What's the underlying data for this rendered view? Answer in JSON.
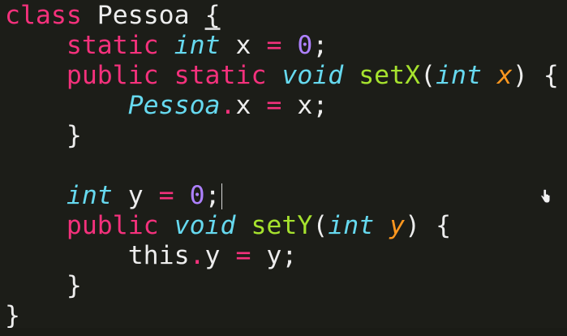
{
  "code": {
    "l1_kw": "class",
    "l1_name": "Pessoa",
    "l1_brace": "{",
    "l2_kw": "static",
    "l2_type": "int",
    "l2_var": "x",
    "l2_op": "=",
    "l2_num": "0",
    "l2_semi": ";",
    "l3_kw1": "public",
    "l3_kw2": "static",
    "l3_type": "void",
    "l3_fn": "setX",
    "l3_paren_open": "(",
    "l3_ptype": "int",
    "l3_param": "x",
    "l3_paren_close": ")",
    "l3_brace": "{",
    "l4_ref": "Pessoa",
    "l4_dot": ".",
    "l4_field": "x",
    "l4_op": "=",
    "l4_val": "x;",
    "l5_close": "}",
    "l7_type": "int",
    "l7_var": "y",
    "l7_op": "=",
    "l7_num": "0",
    "l7_semi": ";",
    "l8_kw": "public",
    "l8_type": "void",
    "l8_fn": "setY",
    "l8_paren_open": "(",
    "l8_ptype": "int",
    "l8_param": "y",
    "l8_paren_close": ")",
    "l8_brace": "{",
    "l9_this": "this",
    "l9_dot": ".",
    "l9_field": "y",
    "l9_op": "=",
    "l9_val": "y;",
    "l10_close": "}",
    "l11_close": "}"
  },
  "colors": {
    "background": "#1c1d18",
    "keyword": "#f4317c",
    "type": "#66d9ef",
    "function": "#a6e22e",
    "number": "#ae81ff",
    "parameter": "#fd971f",
    "text": "#ededed"
  },
  "icons": {
    "pointer": "hand-pointer-icon"
  }
}
